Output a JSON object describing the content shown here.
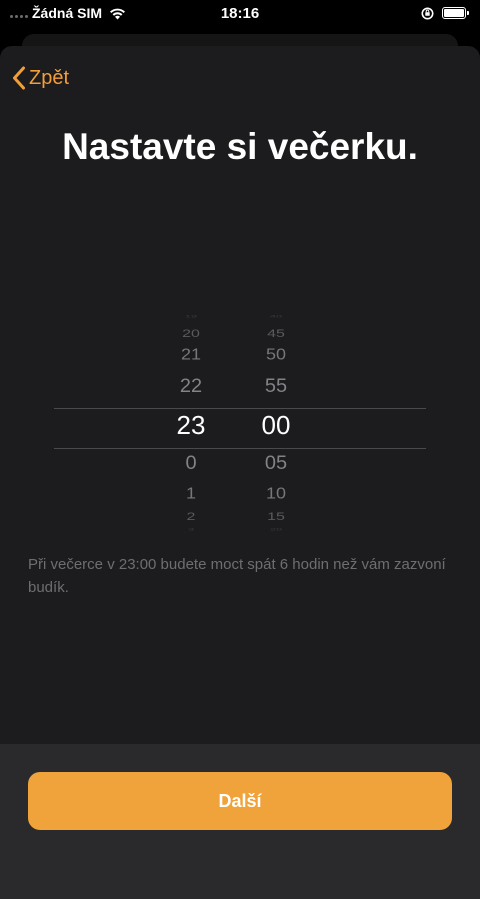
{
  "status_bar": {
    "carrier": "Žádná SIM",
    "time": "18:16"
  },
  "nav": {
    "back_label": "Zpět"
  },
  "title": "Nastavte si večerku.",
  "picker": {
    "hours": [
      "19",
      "20",
      "21",
      "22",
      "23",
      "0",
      "1",
      "2",
      "3"
    ],
    "minutes": [
      "40",
      "45",
      "50",
      "55",
      "00",
      "05",
      "10",
      "15",
      "20"
    ],
    "selected_hour": "23",
    "selected_minute": "00"
  },
  "info_text": "Při večerce v 23:00 budete moct spát 6 hodin než vám zazvoní budík.",
  "footer": {
    "next_label": "Další"
  },
  "colors": {
    "accent": "#f0a33a",
    "background": "#1c1c1e",
    "footer": "#2a2a2c"
  }
}
